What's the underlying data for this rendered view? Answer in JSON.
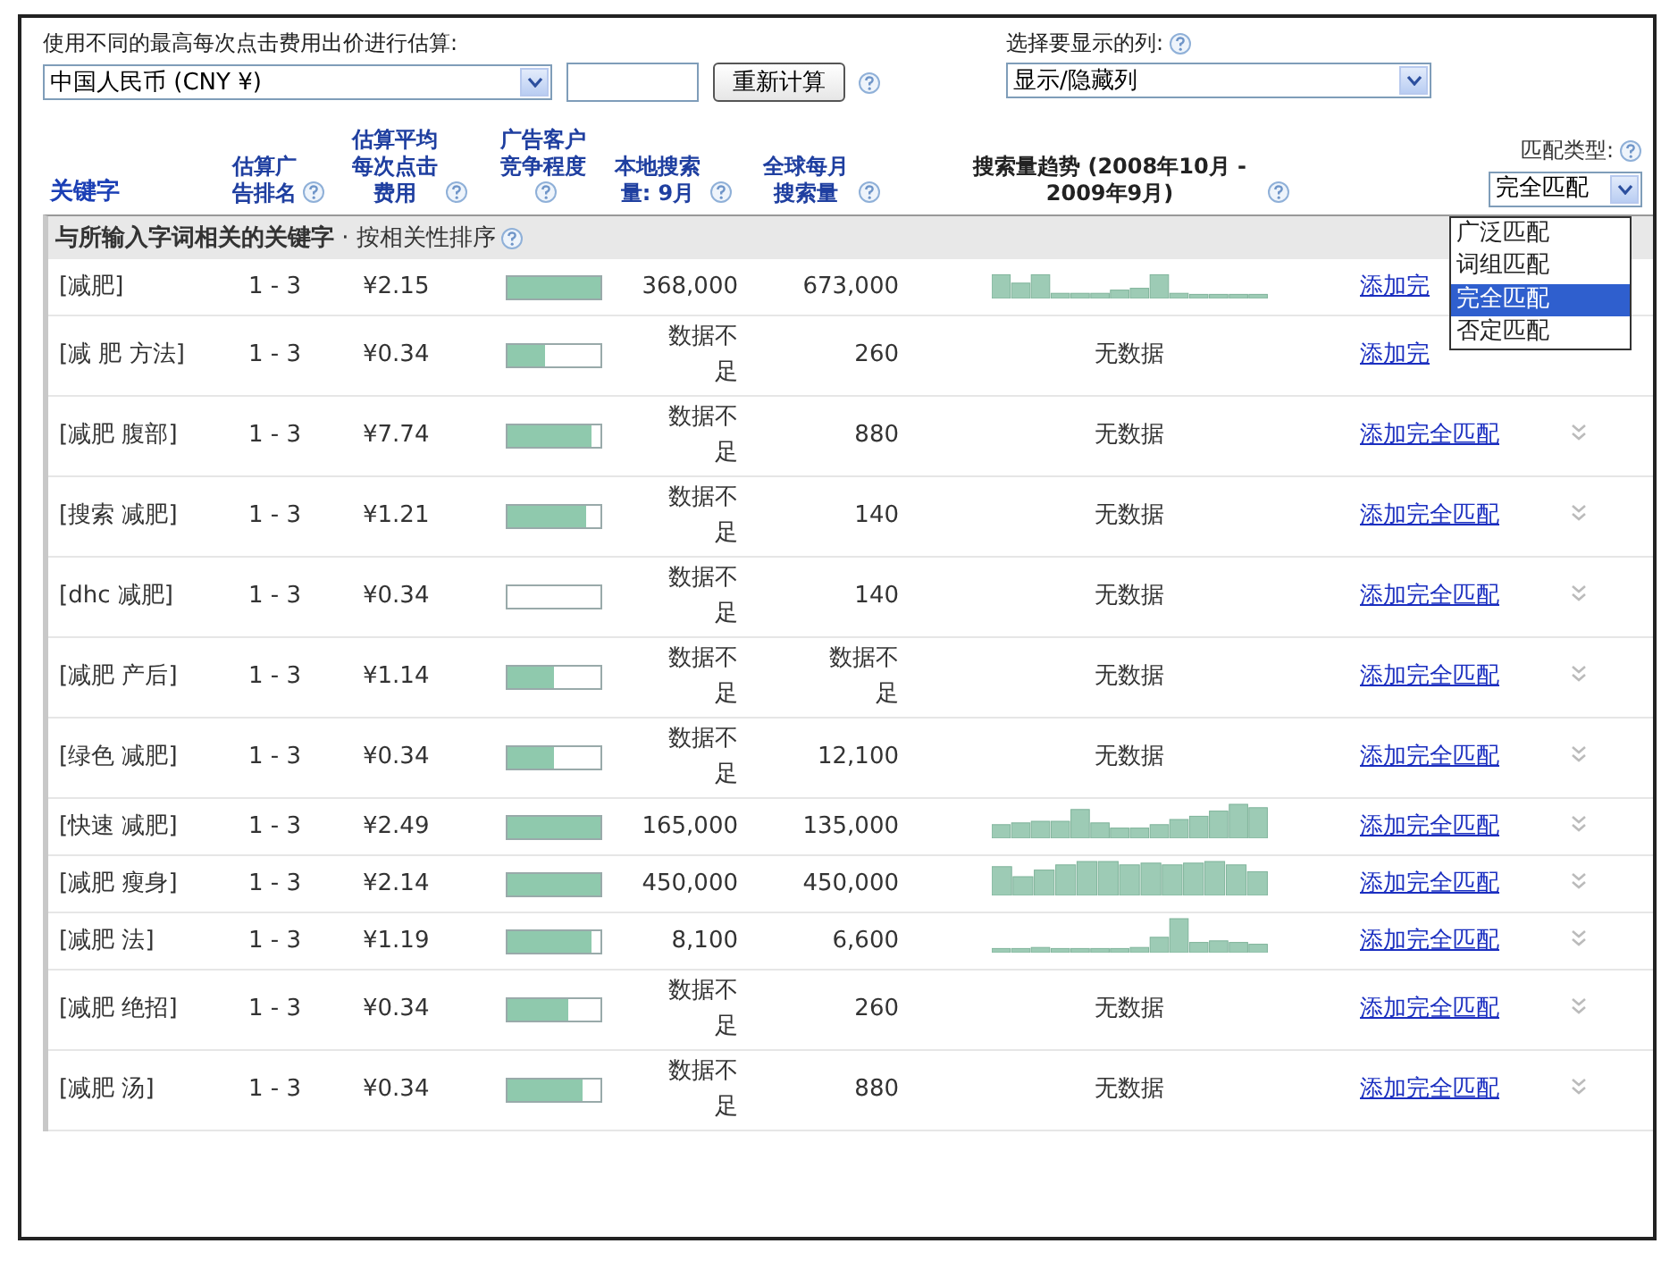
{
  "toolbar": {
    "bid_label": "使用不同的最高每次点击费用出价进行估算:",
    "currency_select": "中国人民币 (CNY ¥)",
    "recalc_button": "重新计算",
    "columns_label": "选择要显示的列:",
    "columns_select": "显示/隐藏列"
  },
  "table": {
    "columns": [
      "关键字",
      "估算广告排名",
      "估算平均每次点击费用",
      "广告客户竞争程度",
      "本地搜索量: 9月",
      "全球每月搜索量",
      "搜索量趋势 (2008年10月 - 2009年9月)",
      "匹配类型:"
    ],
    "match_select": "完全匹配",
    "match_options": [
      {
        "label": "广泛匹配",
        "selected": false
      },
      {
        "label": "词组匹配",
        "selected": false
      },
      {
        "label": "完全匹配",
        "selected": true
      },
      {
        "label": "否定匹配",
        "selected": false
      }
    ],
    "section": "**与所输入字词相关的关键字** · 按相关性排序",
    "rows": [
      {
        "keyword": "[减肥]",
        "rank": "1 - 3",
        "cpc": "¥2.15",
        "competition": {
          "level": 1
        },
        "local": "368,000",
        "global": "673,000",
        "trend": {
          "kind": "sparkline"
        },
        "link": "添加完",
        "chevron": false
      },
      {
        "keyword": "[减 肥 方法]",
        "rank": "1 - 3",
        "cpc": "¥0.34",
        "competition": {
          "level": 0.4
        },
        "local": "数据不足",
        "global": "260",
        "trend": {
          "kind": "text",
          "text": "无数据"
        },
        "link": "添加完",
        "chevron": false
      },
      {
        "keyword": "[减肥 腹部]",
        "rank": "1 - 3",
        "cpc": "¥7.74",
        "competition": {
          "level": 0.9
        },
        "local": "数据不足",
        "global": "880",
        "trend": {
          "kind": "text",
          "text": "无数据"
        },
        "link": "添加完全匹配",
        "chevron": true
      },
      {
        "keyword": "[搜索 减肥]",
        "rank": "1 - 3",
        "cpc": "¥1.21",
        "competition": {
          "level": 0.85
        },
        "local": "数据不足",
        "global": "140",
        "trend": {
          "kind": "text",
          "text": "无数据"
        },
        "link": "添加完全匹配",
        "chevron": true
      },
      {
        "keyword": "[dhc 减肥]",
        "rank": "1 - 3",
        "cpc": "¥0.34",
        "competition": {
          "level": 0
        },
        "local": "数据不足",
        "global": "140",
        "trend": {
          "kind": "text",
          "text": "无数据"
        },
        "link": "添加完全匹配",
        "chevron": true
      },
      {
        "keyword": "[减肥 产后]",
        "rank": "1 - 3",
        "cpc": "¥1.14",
        "competition": {
          "level": 0.5
        },
        "local": "数据不足",
        "global": "数据不足",
        "trend": {
          "kind": "text",
          "text": "无数据"
        },
        "link": "添加完全匹配",
        "chevron": true
      },
      {
        "keyword": "[绿色 减肥]",
        "rank": "1 - 3",
        "cpc": "¥0.34",
        "competition": {
          "level": 0.5
        },
        "local": "数据不足",
        "global": "12,100",
        "trend": {
          "kind": "text",
          "text": "无数据"
        },
        "link": "添加完全匹配",
        "chevron": true
      },
      {
        "keyword": "[快速 减肥]",
        "rank": "1 - 3",
        "cpc": "¥2.49",
        "competition": {
          "level": 1
        },
        "local": "165,000",
        "global": "135,000",
        "trend": {
          "kind": "sparkline"
        },
        "link": "添加完全匹配",
        "chevron": true
      },
      {
        "keyword": "[减肥 瘦身]",
        "rank": "1 - 3",
        "cpc": "¥2.14",
        "competition": {
          "level": 1
        },
        "local": "450,000",
        "global": "450,000",
        "trend": {
          "kind": "sparkline"
        },
        "link": "添加完全匹配",
        "chevron": true
      },
      {
        "keyword": "[减肥 法]",
        "rank": "1 - 3",
        "cpc": "¥1.19",
        "competition": {
          "level": 0.9
        },
        "local": "8,100",
        "global": "6,600",
        "trend": {
          "kind": "sparkline"
        },
        "link": "添加完全匹配",
        "chevron": true
      },
      {
        "keyword": "[减肥 绝招]",
        "rank": "1 - 3",
        "cpc": "¥0.34",
        "competition": {
          "level": 0.65
        },
        "local": "数据不足",
        "global": "260",
        "trend": {
          "kind": "text",
          "text": "无数据"
        },
        "link": "添加完全匹配",
        "chevron": true
      },
      {
        "keyword": "[减肥 汤]",
        "rank": "1 - 3",
        "cpc": "¥0.34",
        "competition": {
          "level": 0.8
        },
        "local": "数据不足",
        "global": "880",
        "trend": {
          "kind": "text",
          "text": "无数据"
        },
        "link": "添加完全匹配",
        "chevron": true
      }
    ]
  }
}
